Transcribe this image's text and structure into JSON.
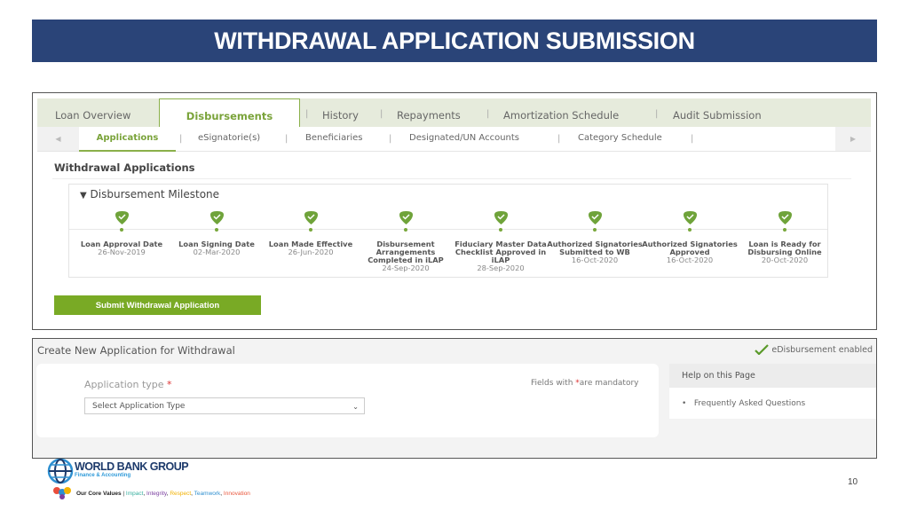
{
  "slide": {
    "title": "WITHDRAWAL APPLICATION SUBMISSION",
    "page_number": "10"
  },
  "tabs": [
    {
      "label": "Loan Overview"
    },
    {
      "label": "Disbursements",
      "active": true
    },
    {
      "label": "History"
    },
    {
      "label": "Repayments"
    },
    {
      "label": "Amortization Schedule"
    },
    {
      "label": "Audit Submission"
    }
  ],
  "subtabs": [
    {
      "label": "Applications",
      "active": true
    },
    {
      "label": "eSignatorie(s)"
    },
    {
      "label": "Beneficiaries"
    },
    {
      "label": "Designated/UN Accounts"
    },
    {
      "label": "Category Schedule"
    }
  ],
  "section_title": "Withdrawal Applications",
  "milestone": {
    "title": "Disbursement Milestone",
    "items": [
      {
        "label": "Loan Approval Date",
        "date": "26-Nov-2019"
      },
      {
        "label": "Loan Signing Date",
        "date": "02-Mar-2020"
      },
      {
        "label": "Loan Made Effective",
        "date": "26-Jun-2020"
      },
      {
        "label": "Disbursement Arrangements Completed in iLAP",
        "date": "24-Sep-2020"
      },
      {
        "label": "Fiduciary Master Data Checklist Approved in iLAP",
        "date": "28-Sep-2020"
      },
      {
        "label": "Authorized Signatories Submitted to WB",
        "date": "16-Oct-2020"
      },
      {
        "label": "Authorized Signatories Approved",
        "date": "16-Oct-2020"
      },
      {
        "label": "Loan is Ready for Disbursing Online",
        "date": "20-Oct-2020"
      }
    ]
  },
  "submit_button": "Submit Withdrawal Application",
  "create": {
    "title": "Create New Application for Withdrawal",
    "edisbursement": "eDisbursement enabled",
    "app_type_label": "Application type",
    "required_mark": "*",
    "mandatory_pre": "Fields with",
    "mandatory_post": "are mandatory",
    "select_placeholder": "Select Application Type"
  },
  "help": {
    "title": "Help on this Page",
    "items": [
      "Frequently Asked Questions"
    ]
  },
  "footer": {
    "org": "WORLD BANK GROUP",
    "unit": "Finance & Accounting",
    "values_label": "Our Core Values",
    "values": [
      "Impact",
      "Integrity",
      "Respect",
      "Teamwork",
      "Innovation"
    ]
  },
  "colors": {
    "title_bg": "#2a4478",
    "accent_green": "#79aa25"
  }
}
